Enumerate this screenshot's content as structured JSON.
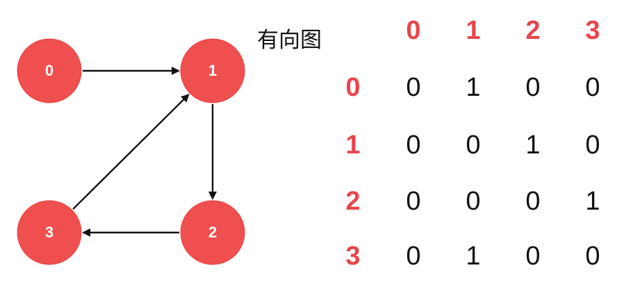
{
  "title": "有向图",
  "graph": {
    "nodes": [
      {
        "id": "0",
        "label": "0"
      },
      {
        "id": "1",
        "label": "1"
      },
      {
        "id": "2",
        "label": "2"
      },
      {
        "id": "3",
        "label": "3"
      }
    ],
    "edges": [
      {
        "from": "0",
        "to": "1"
      },
      {
        "from": "1",
        "to": "2"
      },
      {
        "from": "2",
        "to": "3"
      },
      {
        "from": "3",
        "to": "1"
      }
    ]
  },
  "matrix": {
    "column_headers": [
      "0",
      "1",
      "2",
      "3"
    ],
    "row_headers": [
      "0",
      "1",
      "2",
      "3"
    ],
    "rows": [
      [
        "0",
        "1",
        "0",
        "0"
      ],
      [
        "0",
        "0",
        "1",
        "0"
      ],
      [
        "0",
        "0",
        "0",
        "1"
      ],
      [
        "0",
        "1",
        "0",
        "0"
      ]
    ]
  },
  "colors": {
    "node_fill": "#ef4f4f",
    "header_text": "#e8454c",
    "edge": "#111111",
    "cell_text": "#111111"
  }
}
